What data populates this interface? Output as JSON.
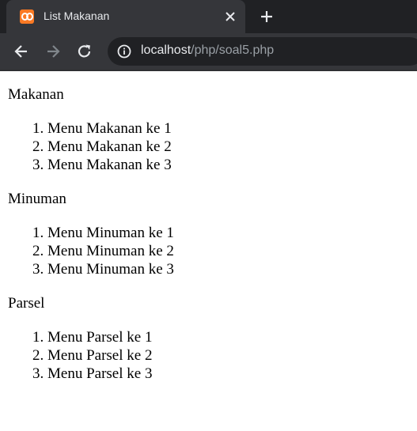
{
  "browser": {
    "tab_title": "List Makanan",
    "url_host": "localhost",
    "url_path": "/php/soal5.php",
    "icons": {
      "favicon": "xampp-icon",
      "close": "close-icon",
      "new_tab": "plus-icon",
      "back": "arrow-left-icon",
      "forward": "arrow-right-icon",
      "reload": "reload-icon",
      "info": "info-icon"
    },
    "colors": {
      "tabstrip": "#202124",
      "toolbar": "#35363a",
      "favicon": "#fb7a24"
    }
  },
  "page": {
    "sections": [
      {
        "label": "Makanan",
        "items": [
          "Menu Makanan ke 1",
          "Menu Makanan ke 2",
          "Menu Makanan ke 3"
        ]
      },
      {
        "label": "Minuman",
        "items": [
          "Menu Minuman ke 1",
          "Menu Minuman ke 2",
          "Menu Minuman ke 3"
        ]
      },
      {
        "label": "Parsel",
        "items": [
          "Menu Parsel ke 1",
          "Menu Parsel ke 2",
          "Menu Parsel ke 3"
        ]
      }
    ]
  }
}
